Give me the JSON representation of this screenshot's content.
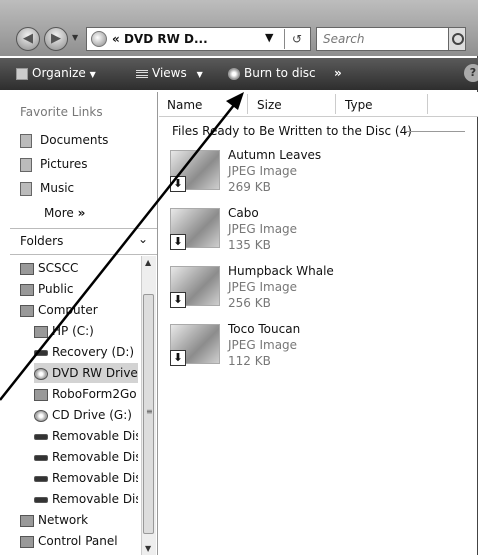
{
  "address": {
    "breadcrumb_prefix": "«",
    "path": "DVD RW D...",
    "search_placeholder": "Search"
  },
  "toolbar": {
    "organize": "Organize",
    "views": "Views",
    "burn": "Burn to disc",
    "overflow": "»",
    "help": "?"
  },
  "favorites": {
    "title": "Favorite Links",
    "items": [
      "Documents",
      "Pictures",
      "Music"
    ],
    "more": "More"
  },
  "folders": {
    "title": "Folders",
    "items": [
      "SCSCC",
      "Public",
      "Computer",
      "HP (C:)",
      "Recovery (D:)",
      "DVD RW Drive",
      "RoboForm2Go",
      "CD Drive (G:)",
      "Removable Disk",
      "Removable Disk",
      "Removable Disk",
      "Removable Disk",
      "Network",
      "Control Panel"
    ]
  },
  "columns": [
    "Name",
    "Size",
    "Type"
  ],
  "group_label": "Files Ready to Be Written to the Disc (4)",
  "files": [
    {
      "name": "Autumn Leaves",
      "type": "JPEG Image",
      "size": "269 KB"
    },
    {
      "name": "Cabo",
      "type": "JPEG Image",
      "size": "135 KB"
    },
    {
      "name": "Humpback Whale",
      "type": "JPEG Image",
      "size": "256 KB"
    },
    {
      "name": "Toco Toucan",
      "type": "JPEG Image",
      "size": "112 KB"
    }
  ]
}
